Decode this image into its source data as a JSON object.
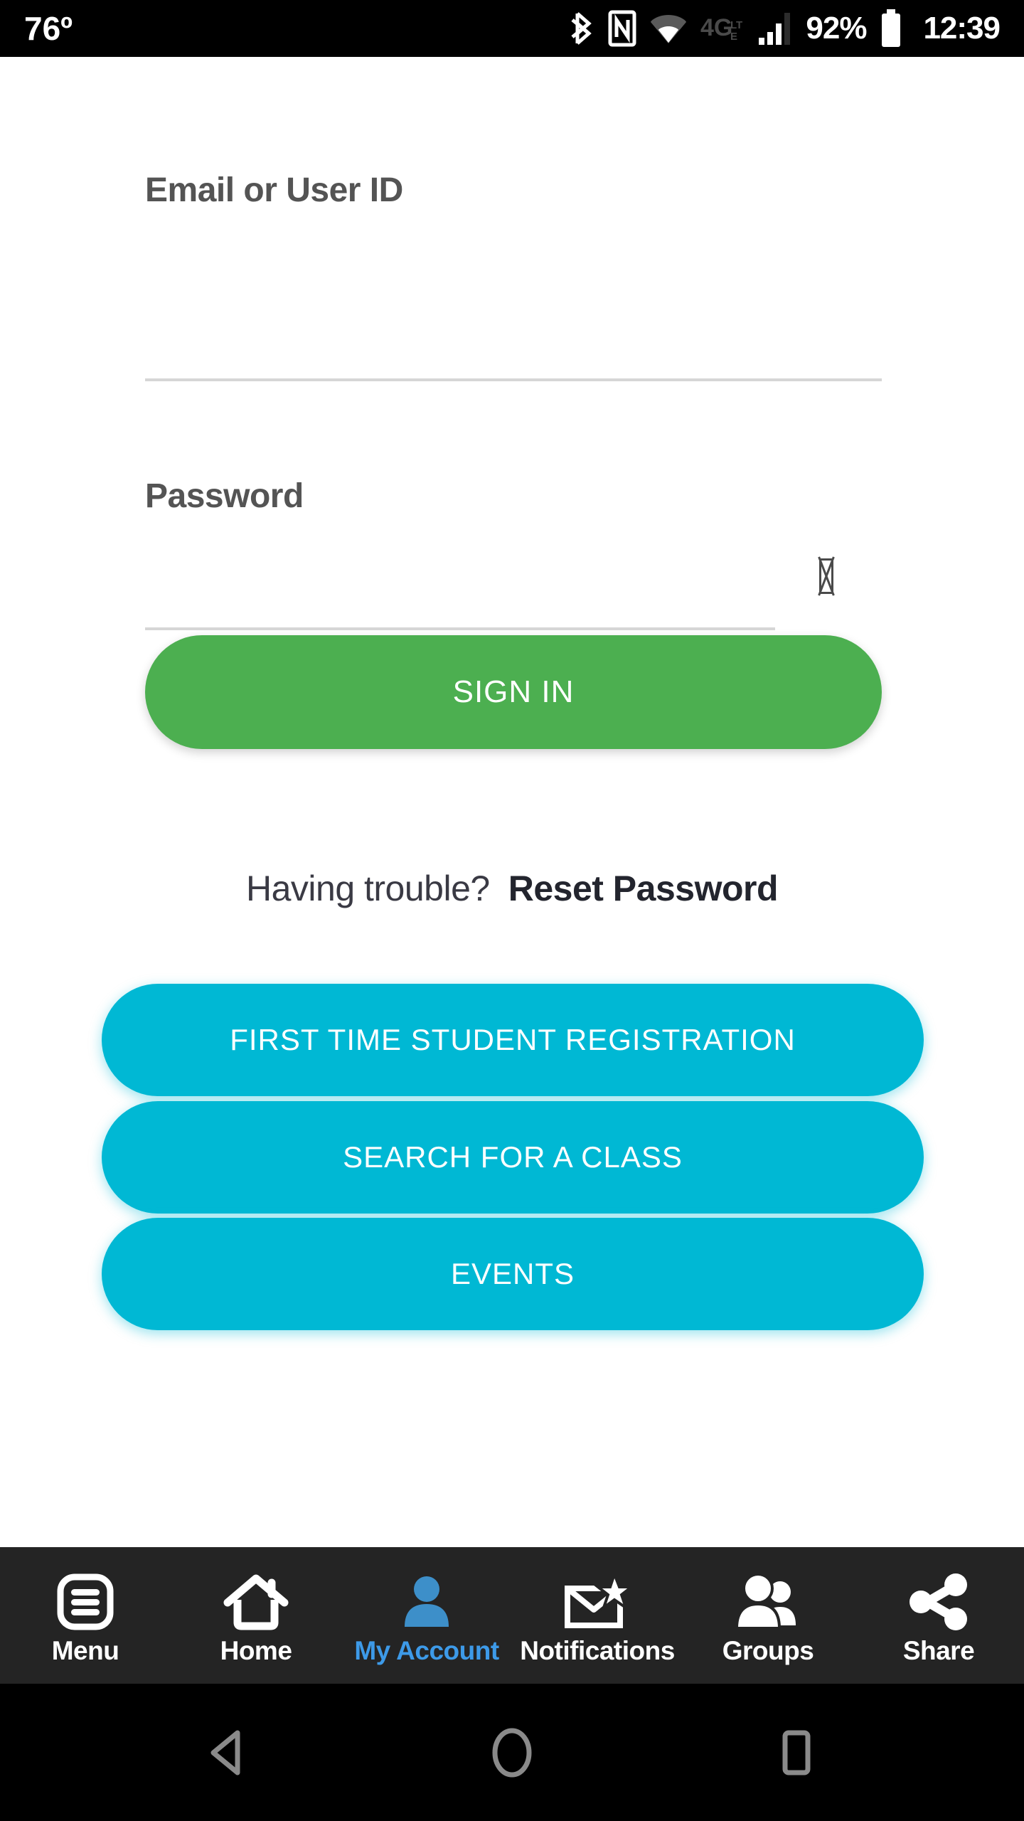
{
  "status_bar": {
    "temperature": "76º",
    "battery_percent": "92%",
    "clock": "12:39",
    "icons": [
      "bluetooth-icon",
      "nfc-icon",
      "wifi-icon",
      "4g-lte-icon",
      "cellular-signal-icon",
      "battery-icon"
    ]
  },
  "form": {
    "email": {
      "label": "Email or User ID",
      "value": "",
      "placeholder": ""
    },
    "password": {
      "label": "Password",
      "value": "",
      "placeholder": "",
      "toggle_icon": "missing-glyph-box-icon"
    },
    "sign_in_label": "SIGN IN",
    "sign_in_color": "#4CAF50"
  },
  "helper": {
    "question": "Having trouble?",
    "link_label": "Reset Password"
  },
  "actions": {
    "accent_color": "#00B8D4",
    "buttons": [
      {
        "label": "FIRST TIME STUDENT REGISTRATION"
      },
      {
        "label": "SEARCH FOR A CLASS"
      },
      {
        "label": "EVENTS"
      }
    ]
  },
  "bottom_nav": {
    "active_color": "#3d9ae8",
    "items": [
      {
        "label": "Menu",
        "icon": "menu-list-icon",
        "active": false
      },
      {
        "label": "Home",
        "icon": "home-icon",
        "active": false
      },
      {
        "label": "My Account",
        "icon": "person-icon",
        "active": true
      },
      {
        "label": "Notifications",
        "icon": "envelope-star-icon",
        "active": false
      },
      {
        "label": "Groups",
        "icon": "people-group-icon",
        "active": false
      },
      {
        "label": "Share",
        "icon": "share-nodes-icon",
        "active": false
      }
    ]
  },
  "system_nav": {
    "back_label": "Back",
    "home_label": "Home",
    "recents_label": "Recent apps"
  }
}
